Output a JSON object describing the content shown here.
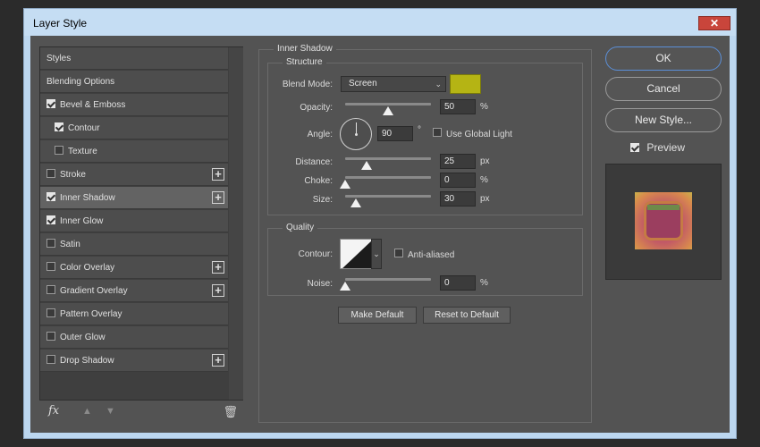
{
  "window": {
    "title": "Layer Style",
    "close_label": "✕"
  },
  "styles_list": {
    "items": [
      {
        "label": "Styles",
        "checkbox": false,
        "checked": false,
        "plus": false,
        "sub": false,
        "selected": false
      },
      {
        "label": "Blending Options",
        "checkbox": false,
        "checked": false,
        "plus": false,
        "sub": false,
        "selected": false
      },
      {
        "label": "Bevel & Emboss",
        "checkbox": true,
        "checked": true,
        "plus": false,
        "sub": false,
        "selected": false
      },
      {
        "label": "Contour",
        "checkbox": true,
        "checked": true,
        "plus": false,
        "sub": true,
        "selected": false
      },
      {
        "label": "Texture",
        "checkbox": true,
        "checked": false,
        "plus": false,
        "sub": true,
        "selected": false
      },
      {
        "label": "Stroke",
        "checkbox": true,
        "checked": false,
        "plus": true,
        "sub": false,
        "selected": false
      },
      {
        "label": "Inner Shadow",
        "checkbox": true,
        "checked": true,
        "plus": true,
        "sub": false,
        "selected": true
      },
      {
        "label": "Inner Glow",
        "checkbox": true,
        "checked": true,
        "plus": false,
        "sub": false,
        "selected": false
      },
      {
        "label": "Satin",
        "checkbox": true,
        "checked": false,
        "plus": false,
        "sub": false,
        "selected": false
      },
      {
        "label": "Color Overlay",
        "checkbox": true,
        "checked": false,
        "plus": true,
        "sub": false,
        "selected": false
      },
      {
        "label": "Gradient Overlay",
        "checkbox": true,
        "checked": false,
        "plus": true,
        "sub": false,
        "selected": false
      },
      {
        "label": "Pattern Overlay",
        "checkbox": true,
        "checked": false,
        "plus": false,
        "sub": false,
        "selected": false
      },
      {
        "label": "Outer Glow",
        "checkbox": true,
        "checked": false,
        "plus": false,
        "sub": false,
        "selected": false
      },
      {
        "label": "Drop Shadow",
        "checkbox": true,
        "checked": false,
        "plus": true,
        "sub": false,
        "selected": false
      }
    ],
    "fx_label": "fx"
  },
  "inner_shadow": {
    "section_title": "Inner Shadow",
    "structure": {
      "title": "Structure",
      "blend_mode_label": "Blend Mode:",
      "blend_mode_value": "Screen",
      "shadow_color": "#b5b414",
      "opacity_label": "Opacity:",
      "opacity_value": "50",
      "opacity_unit": "%",
      "opacity_fraction": 0.5,
      "angle_label": "Angle:",
      "angle_value": "90",
      "angle_unit": "°",
      "use_global_light_label": "Use Global Light",
      "use_global_light": false,
      "distance_label": "Distance:",
      "distance_value": "25",
      "distance_unit": "px",
      "distance_fraction": 0.25,
      "choke_label": "Choke:",
      "choke_value": "0",
      "choke_unit": "%",
      "choke_fraction": 0,
      "size_label": "Size:",
      "size_value": "30",
      "size_unit": "px",
      "size_fraction": 0.12
    },
    "quality": {
      "title": "Quality",
      "contour_label": "Contour:",
      "anti_aliased_label": "Anti-aliased",
      "anti_aliased": false,
      "noise_label": "Noise:",
      "noise_value": "0",
      "noise_unit": "%",
      "noise_fraction": 0
    },
    "make_default_label": "Make Default",
    "reset_default_label": "Reset to Default"
  },
  "actions": {
    "ok_label": "OK",
    "cancel_label": "Cancel",
    "new_style_label": "New Style...",
    "preview_label": "Preview",
    "preview_checked": true
  }
}
